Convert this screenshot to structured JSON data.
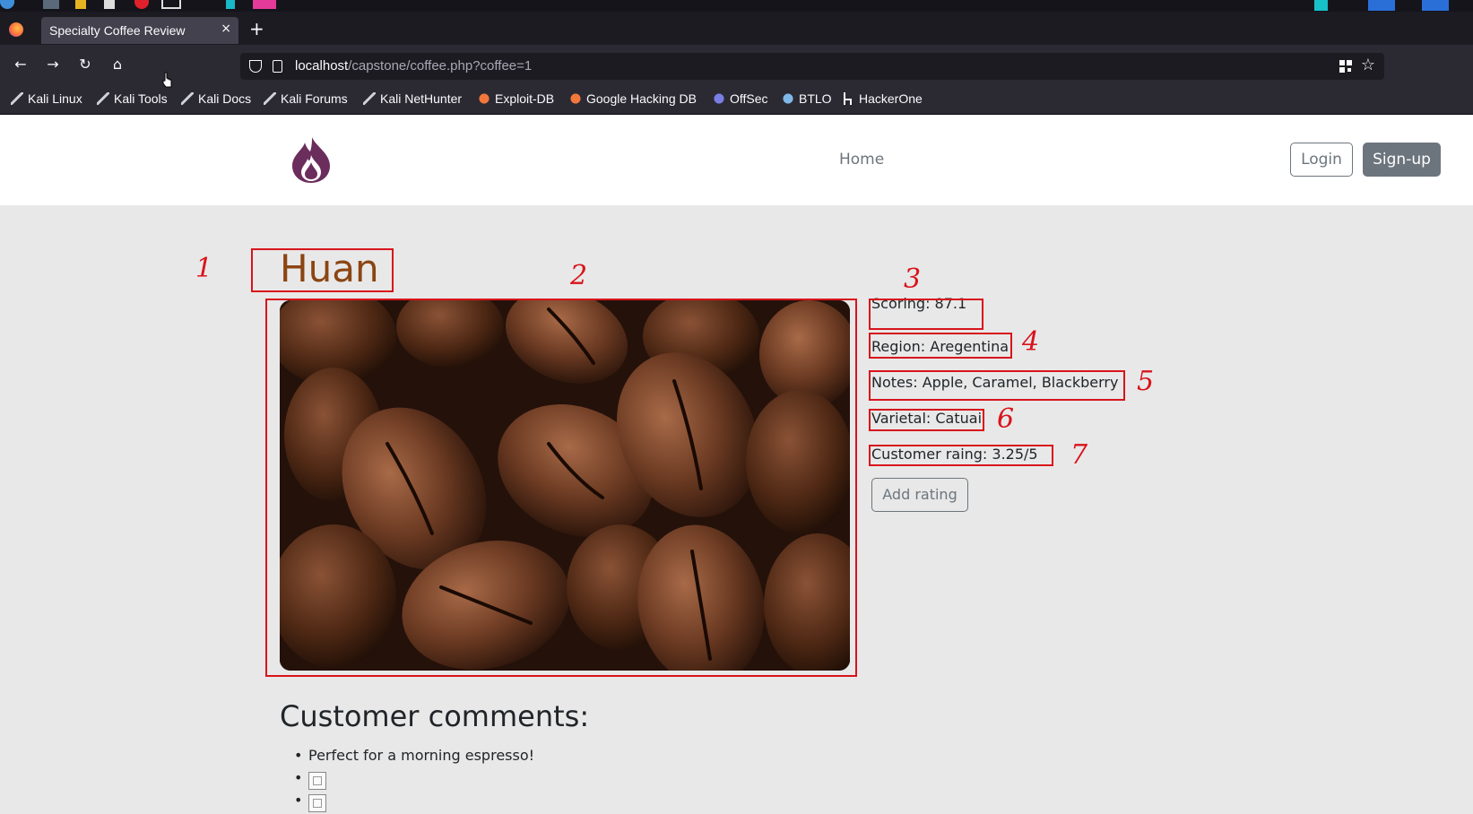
{
  "browser": {
    "tab_title": "Specialty Coffee Review",
    "tab_close": "×",
    "new_tab": "+",
    "url_host": "localhost",
    "url_path": "/capstone/coffee.php?coffee=1",
    "nav": {
      "back": "←",
      "forward": "→",
      "reload": "↻",
      "home": "⌂"
    },
    "star": "☆",
    "bookmarks": [
      {
        "label": "Kali Linux",
        "icon": "kali-icon"
      },
      {
        "label": "Kali Tools",
        "icon": "kali-icon"
      },
      {
        "label": "Kali Docs",
        "icon": "kali-icon"
      },
      {
        "label": "Kali Forums",
        "icon": "kali-icon"
      },
      {
        "label": "Kali NetHunter",
        "icon": "kali-icon"
      },
      {
        "label": "Exploit-DB",
        "icon": "exploit-db-icon"
      },
      {
        "label": "Google Hacking DB",
        "icon": "exploit-db-icon"
      },
      {
        "label": "OffSec",
        "icon": "offsec-icon"
      },
      {
        "label": "BTLO",
        "icon": "btlo-icon"
      },
      {
        "label": "HackerOne",
        "icon": "hackerone-icon"
      }
    ]
  },
  "site": {
    "nav_home": "Home",
    "login": "Login",
    "signup": "Sign-up",
    "logo_color": "#6b2d5c"
  },
  "coffee": {
    "title": "Huan",
    "scoring": "Scoring: 87.1",
    "region": "Region: Aregentina",
    "notes": "Notes: Apple, Caramel, Blackberry",
    "varietal": "Varietal: Catuai",
    "customer_rating": "Customer raing: 3.25/5",
    "add_rating": "Add rating",
    "image": "coffee-beans-photo"
  },
  "comments": {
    "heading": "Customer comments:",
    "items": [
      "Perfect for a morning espresso!"
    ],
    "broken_images": 2
  },
  "annotations": {
    "color": "#d8141c",
    "numbers": [
      "1",
      "2",
      "3",
      "4",
      "5",
      "6",
      "7"
    ]
  }
}
